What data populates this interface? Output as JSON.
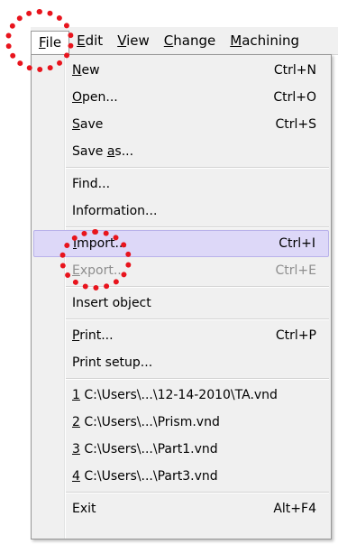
{
  "menubar": {
    "items": [
      {
        "pre": "",
        "u": "F",
        "post": "ile"
      },
      {
        "pre": "",
        "u": "E",
        "post": "dit"
      },
      {
        "pre": "",
        "u": "V",
        "post": "iew"
      },
      {
        "pre": "",
        "u": "C",
        "post": "hange"
      },
      {
        "pre": "",
        "u": "M",
        "post": "achining"
      }
    ]
  },
  "file_menu": {
    "new": {
      "pre": "",
      "u": "N",
      "post": "ew",
      "shortcut": "Ctrl+N"
    },
    "open": {
      "pre": "",
      "u": "O",
      "post": "pen...",
      "shortcut": "Ctrl+O"
    },
    "save": {
      "pre": "",
      "u": "S",
      "post": "ave",
      "shortcut": "Ctrl+S"
    },
    "save_as": {
      "pre": "Save ",
      "u": "a",
      "post": "s..."
    },
    "find": {
      "label": "Find..."
    },
    "information": {
      "label": "Information..."
    },
    "import": {
      "pre": "",
      "u": "I",
      "post": "mport...",
      "shortcut": "Ctrl+I"
    },
    "export": {
      "pre": "",
      "u": "E",
      "post": "xport...",
      "shortcut": "Ctrl+E"
    },
    "insert_object": {
      "label": "Insert object"
    },
    "print": {
      "pre": "",
      "u": "P",
      "post": "rint...",
      "shortcut": "Ctrl+P"
    },
    "print_setup": {
      "label": "Print setup..."
    },
    "recent": [
      {
        "u": "1",
        "post": " C:\\Users\\...\\12-14-2010\\TA.vnd"
      },
      {
        "u": "2",
        "post": " C:\\Users\\...\\Prism.vnd"
      },
      {
        "u": "3",
        "post": " C:\\Users\\...\\Part1.vnd"
      },
      {
        "u": "4",
        "post": " C:\\Users\\...\\Part3.vnd"
      }
    ],
    "exit": {
      "label": "Exit",
      "shortcut": "Alt+F4"
    }
  },
  "colors": {
    "annotation": "#e8141d",
    "highlight": "#ddd8f8"
  }
}
